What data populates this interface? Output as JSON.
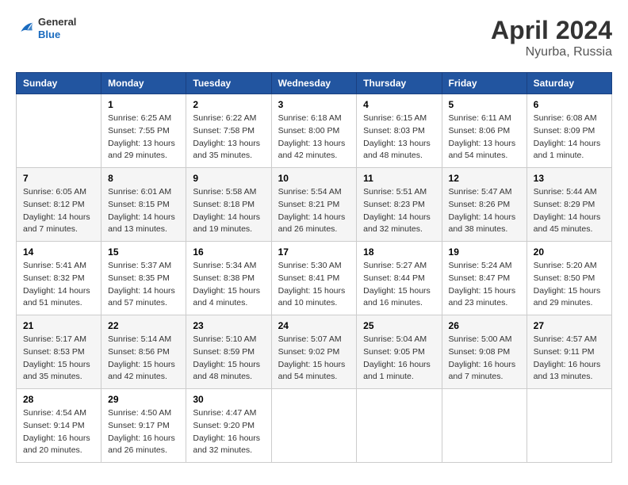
{
  "header": {
    "logo": {
      "general": "General",
      "blue": "Blue"
    },
    "title": "April 2024",
    "location": "Nyurba, Russia"
  },
  "days_of_week": [
    "Sunday",
    "Monday",
    "Tuesday",
    "Wednesday",
    "Thursday",
    "Friday",
    "Saturday"
  ],
  "weeks": [
    [
      {
        "day": "",
        "info": ""
      },
      {
        "day": "1",
        "info": "Sunrise: 6:25 AM\nSunset: 7:55 PM\nDaylight: 13 hours\nand 29 minutes."
      },
      {
        "day": "2",
        "info": "Sunrise: 6:22 AM\nSunset: 7:58 PM\nDaylight: 13 hours\nand 35 minutes."
      },
      {
        "day": "3",
        "info": "Sunrise: 6:18 AM\nSunset: 8:00 PM\nDaylight: 13 hours\nand 42 minutes."
      },
      {
        "day": "4",
        "info": "Sunrise: 6:15 AM\nSunset: 8:03 PM\nDaylight: 13 hours\nand 48 minutes."
      },
      {
        "day": "5",
        "info": "Sunrise: 6:11 AM\nSunset: 8:06 PM\nDaylight: 13 hours\nand 54 minutes."
      },
      {
        "day": "6",
        "info": "Sunrise: 6:08 AM\nSunset: 8:09 PM\nDaylight: 14 hours\nand 1 minute."
      }
    ],
    [
      {
        "day": "7",
        "info": "Sunrise: 6:05 AM\nSunset: 8:12 PM\nDaylight: 14 hours\nand 7 minutes."
      },
      {
        "day": "8",
        "info": "Sunrise: 6:01 AM\nSunset: 8:15 PM\nDaylight: 14 hours\nand 13 minutes."
      },
      {
        "day": "9",
        "info": "Sunrise: 5:58 AM\nSunset: 8:18 PM\nDaylight: 14 hours\nand 19 minutes."
      },
      {
        "day": "10",
        "info": "Sunrise: 5:54 AM\nSunset: 8:21 PM\nDaylight: 14 hours\nand 26 minutes."
      },
      {
        "day": "11",
        "info": "Sunrise: 5:51 AM\nSunset: 8:23 PM\nDaylight: 14 hours\nand 32 minutes."
      },
      {
        "day": "12",
        "info": "Sunrise: 5:47 AM\nSunset: 8:26 PM\nDaylight: 14 hours\nand 38 minutes."
      },
      {
        "day": "13",
        "info": "Sunrise: 5:44 AM\nSunset: 8:29 PM\nDaylight: 14 hours\nand 45 minutes."
      }
    ],
    [
      {
        "day": "14",
        "info": "Sunrise: 5:41 AM\nSunset: 8:32 PM\nDaylight: 14 hours\nand 51 minutes."
      },
      {
        "day": "15",
        "info": "Sunrise: 5:37 AM\nSunset: 8:35 PM\nDaylight: 14 hours\nand 57 minutes."
      },
      {
        "day": "16",
        "info": "Sunrise: 5:34 AM\nSunset: 8:38 PM\nDaylight: 15 hours\nand 4 minutes."
      },
      {
        "day": "17",
        "info": "Sunrise: 5:30 AM\nSunset: 8:41 PM\nDaylight: 15 hours\nand 10 minutes."
      },
      {
        "day": "18",
        "info": "Sunrise: 5:27 AM\nSunset: 8:44 PM\nDaylight: 15 hours\nand 16 minutes."
      },
      {
        "day": "19",
        "info": "Sunrise: 5:24 AM\nSunset: 8:47 PM\nDaylight: 15 hours\nand 23 minutes."
      },
      {
        "day": "20",
        "info": "Sunrise: 5:20 AM\nSunset: 8:50 PM\nDaylight: 15 hours\nand 29 minutes."
      }
    ],
    [
      {
        "day": "21",
        "info": "Sunrise: 5:17 AM\nSunset: 8:53 PM\nDaylight: 15 hours\nand 35 minutes."
      },
      {
        "day": "22",
        "info": "Sunrise: 5:14 AM\nSunset: 8:56 PM\nDaylight: 15 hours\nand 42 minutes."
      },
      {
        "day": "23",
        "info": "Sunrise: 5:10 AM\nSunset: 8:59 PM\nDaylight: 15 hours\nand 48 minutes."
      },
      {
        "day": "24",
        "info": "Sunrise: 5:07 AM\nSunset: 9:02 PM\nDaylight: 15 hours\nand 54 minutes."
      },
      {
        "day": "25",
        "info": "Sunrise: 5:04 AM\nSunset: 9:05 PM\nDaylight: 16 hours\nand 1 minute."
      },
      {
        "day": "26",
        "info": "Sunrise: 5:00 AM\nSunset: 9:08 PM\nDaylight: 16 hours\nand 7 minutes."
      },
      {
        "day": "27",
        "info": "Sunrise: 4:57 AM\nSunset: 9:11 PM\nDaylight: 16 hours\nand 13 minutes."
      }
    ],
    [
      {
        "day": "28",
        "info": "Sunrise: 4:54 AM\nSunset: 9:14 PM\nDaylight: 16 hours\nand 20 minutes."
      },
      {
        "day": "29",
        "info": "Sunrise: 4:50 AM\nSunset: 9:17 PM\nDaylight: 16 hours\nand 26 minutes."
      },
      {
        "day": "30",
        "info": "Sunrise: 4:47 AM\nSunset: 9:20 PM\nDaylight: 16 hours\nand 32 minutes."
      },
      {
        "day": "",
        "info": ""
      },
      {
        "day": "",
        "info": ""
      },
      {
        "day": "",
        "info": ""
      },
      {
        "day": "",
        "info": ""
      }
    ]
  ]
}
